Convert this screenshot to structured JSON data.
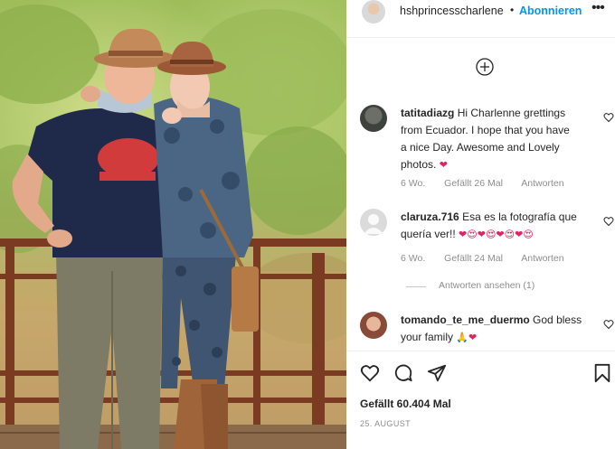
{
  "post": {
    "username": "hshprincesscharlene",
    "separator": "•",
    "follow_label": "Abonnieren",
    "more_label": "•••"
  },
  "comments": [
    {
      "user": "tatitadiazg",
      "text": "Hi Charlenne grettings from Ecuador. I hope that you have a nice Day. Awesome and Lovely photos.",
      "line1": "Hi Charlenne grettings",
      "line2": "from Ecuador. I hope that you have",
      "line3": "a nice Day. Awesome and Lovely",
      "line4": "photos.",
      "emoji": "❤",
      "time": "6 Wo.",
      "likes": "Gefällt 26 Mal",
      "reply": "Antworten"
    },
    {
      "user": "claruza.716",
      "line1": "Esa es la fotografía que",
      "line2": "quería ver!!",
      "emoji": "❤😍❤😍❤😍❤😍",
      "time": "6 Wo.",
      "likes": "Gefällt 24 Mal",
      "reply": "Antworten"
    },
    {
      "user": "tomando_te_me_duermo",
      "line1": "God bless",
      "line2": "your family",
      "emoji": "🙏❤",
      "time": "",
      "likes": "",
      "reply": ""
    }
  ],
  "view_replies": "Antworten ansehen (1)",
  "actions": {
    "like_icon": "heart-icon",
    "comment_icon": "comment-icon",
    "share_icon": "share-icon",
    "save_icon": "bookmark-icon"
  },
  "post_likes": "Gefällt 60.404 Mal",
  "post_date": "25. AUGUST",
  "colors": {
    "accent": "#0095f6",
    "text": "#262626",
    "muted": "#8e8e8e",
    "heart": "#e0245e"
  }
}
